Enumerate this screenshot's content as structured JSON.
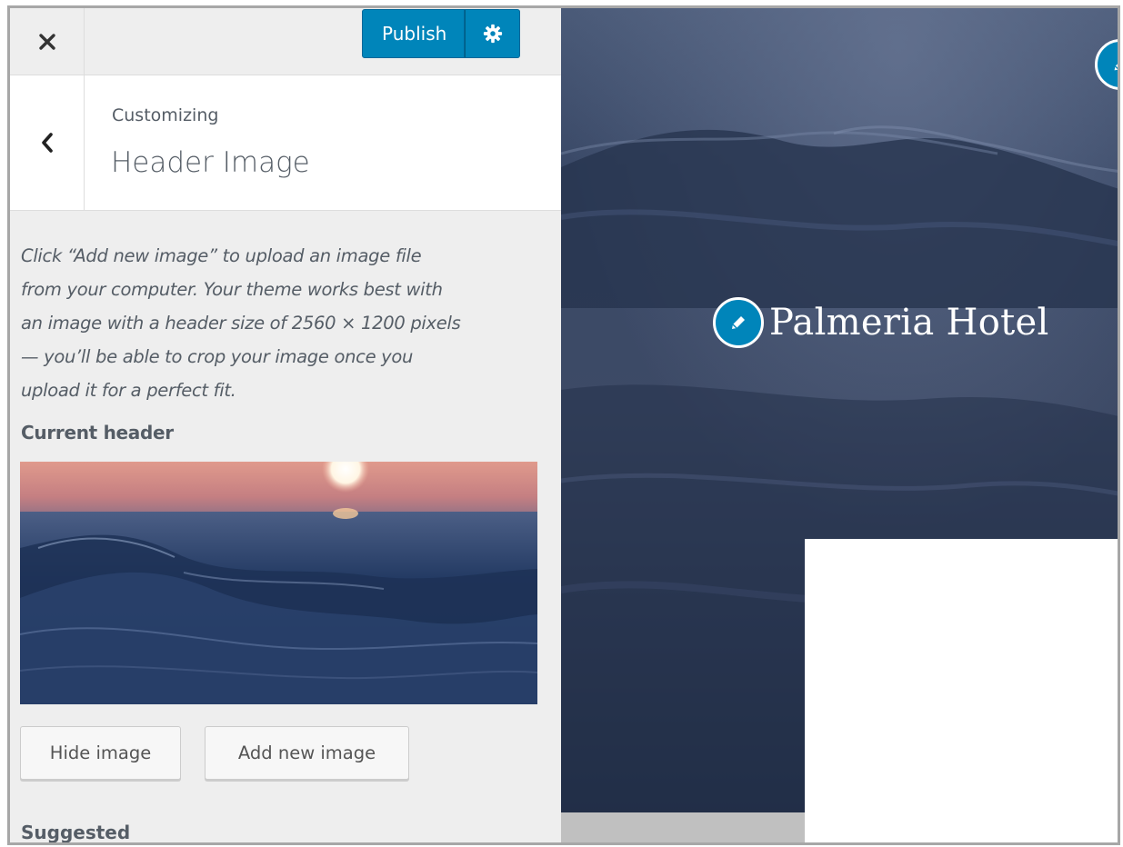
{
  "topbar": {
    "close_icon": "close-icon",
    "publish_label": "Publish",
    "settings_icon": "gear-icon",
    "accent_color": "#0085ba"
  },
  "section": {
    "back_icon": "chevron-left-icon",
    "breadcrumb": "Customizing",
    "title": "Header Image"
  },
  "panel": {
    "description_lines": [
      "Click “Add new image” to upload an image file",
      "from your computer. Your theme works best with",
      "an image with a header size of 2560 × 1200 pixels",
      "— you’ll be able to crop your image once you",
      "upload it for a perfect fit."
    ],
    "current_header_label": "Current header",
    "hide_button": "Hide image",
    "add_button": "Add new image",
    "suggested_label": "Suggested"
  },
  "preview": {
    "site_title": "Palmeria Hotel",
    "edit_icon": "pencil-icon"
  }
}
